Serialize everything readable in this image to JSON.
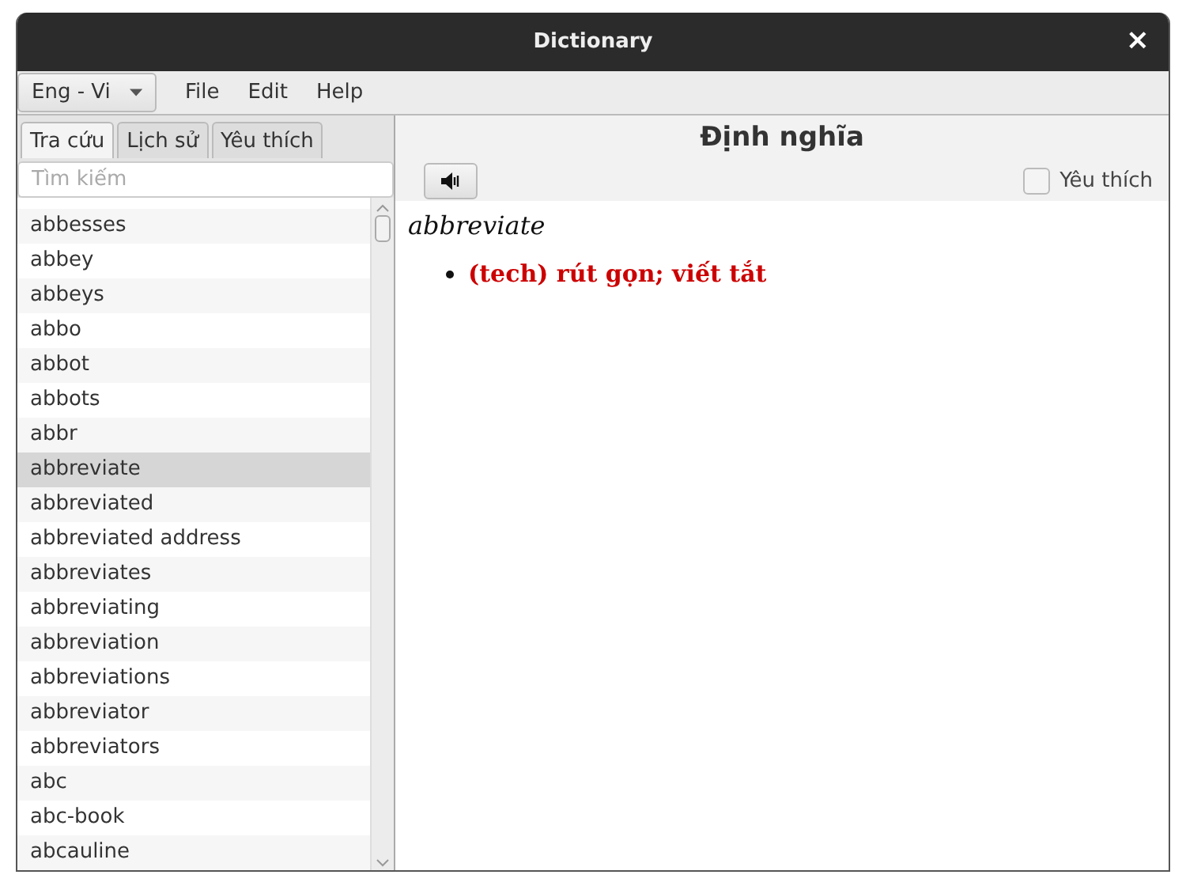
{
  "window": {
    "title": "Dictionary",
    "close": "×"
  },
  "language_selector": {
    "value": "Eng - Vi"
  },
  "menu": [
    "File",
    "Edit",
    "Help"
  ],
  "tabs": [
    {
      "label": "Tra cứu",
      "selected": true
    },
    {
      "label": "Lịch sử",
      "selected": false
    },
    {
      "label": "Yêu thích",
      "selected": false
    }
  ],
  "search": {
    "placeholder": "Tìm kiếm"
  },
  "words": [
    {
      "text": "abbesses",
      "selected": false
    },
    {
      "text": "abbey",
      "selected": false
    },
    {
      "text": "abbeys",
      "selected": false
    },
    {
      "text": "abbo",
      "selected": false
    },
    {
      "text": "abbot",
      "selected": false
    },
    {
      "text": "abbots",
      "selected": false
    },
    {
      "text": "abbr",
      "selected": false
    },
    {
      "text": "abbreviate",
      "selected": true
    },
    {
      "text": "abbreviated",
      "selected": false
    },
    {
      "text": "abbreviated address",
      "selected": false
    },
    {
      "text": "abbreviates",
      "selected": false
    },
    {
      "text": "abbreviating",
      "selected": false
    },
    {
      "text": "abbreviation",
      "selected": false
    },
    {
      "text": "abbreviations",
      "selected": false
    },
    {
      "text": "abbreviator",
      "selected": false
    },
    {
      "text": "abbreviators",
      "selected": false
    },
    {
      "text": "abc",
      "selected": false
    },
    {
      "text": "abc-book",
      "selected": false
    },
    {
      "text": "abcauline",
      "selected": false
    }
  ],
  "definition": {
    "heading": "Định nghĩa",
    "favorite": {
      "label": "Yêu thích",
      "checked": false
    },
    "word": "abbreviate",
    "meanings": [
      "(tech) rút gọn; viết tắt"
    ]
  }
}
